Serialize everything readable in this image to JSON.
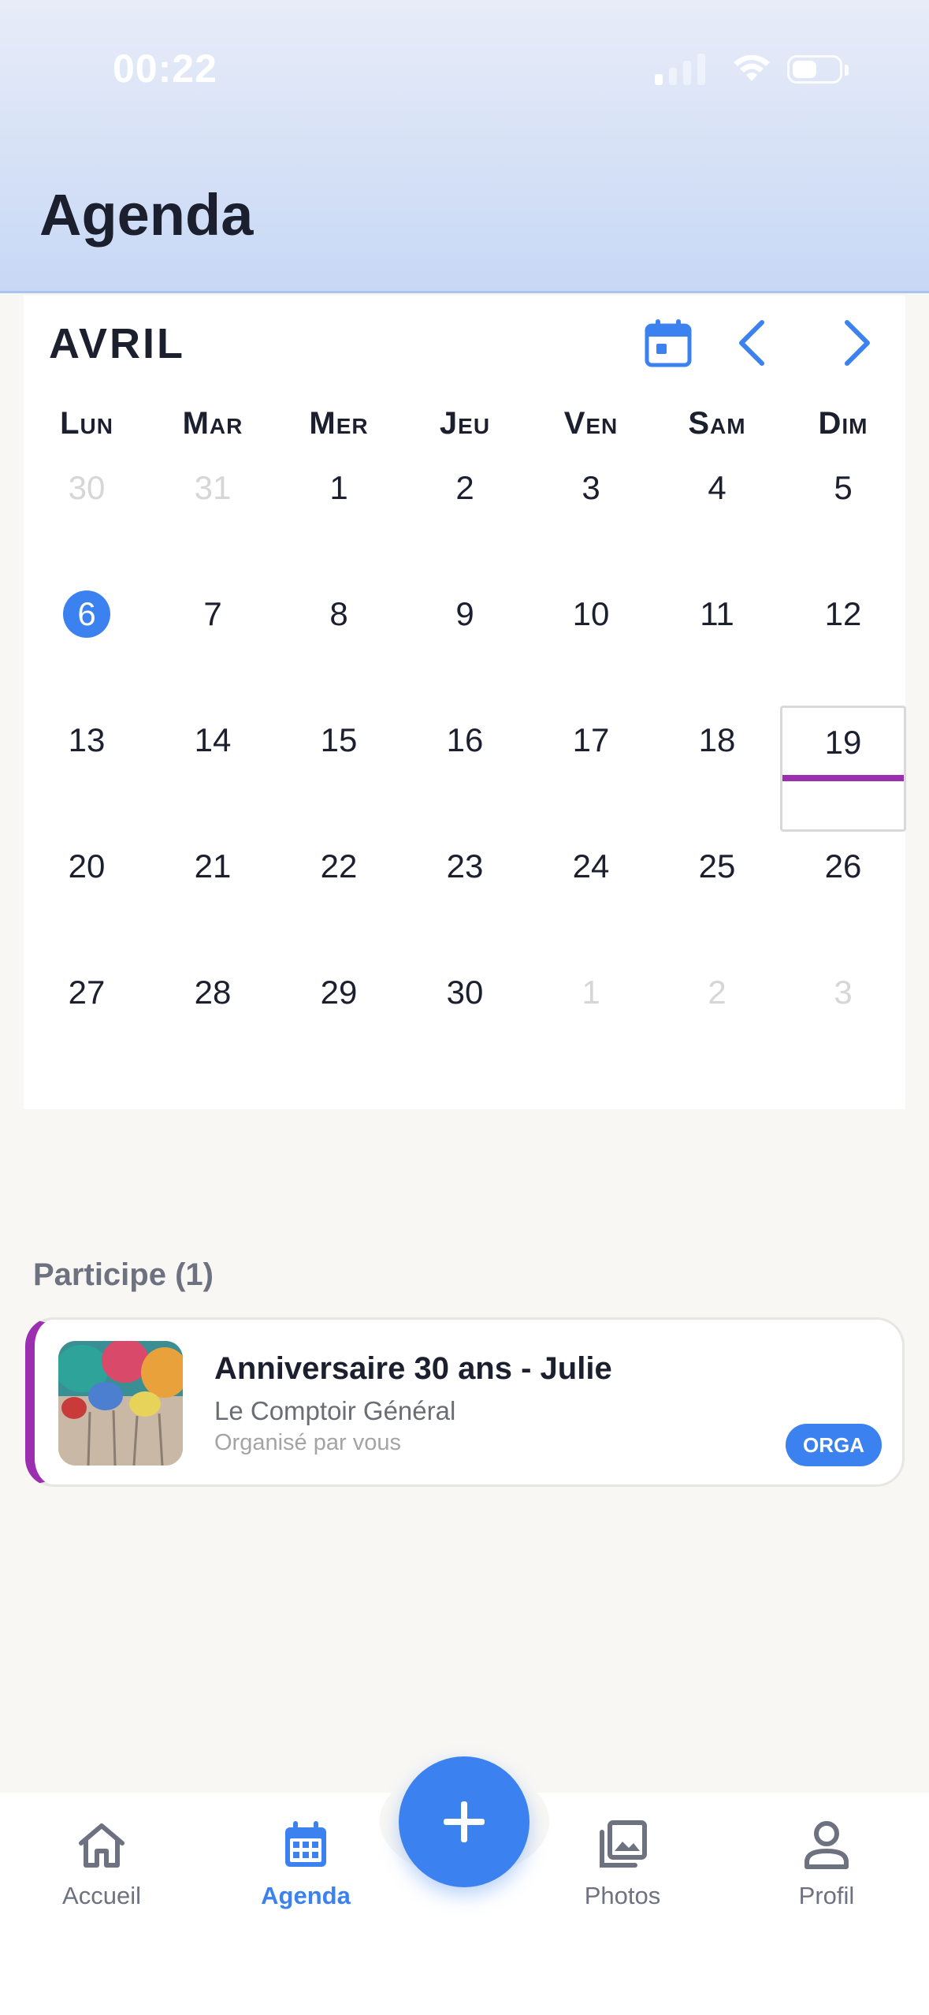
{
  "status_bar": {
    "time": "00:22"
  },
  "header": {
    "title": "Agenda"
  },
  "calendar": {
    "month": "AVRIL",
    "weekdays": [
      "Lun",
      "Mar",
      "Mer",
      "Jeu",
      "Ven",
      "Sam",
      "Dim"
    ],
    "days": [
      {
        "label": "30",
        "muted": true
      },
      {
        "label": "31",
        "muted": true
      },
      {
        "label": "1"
      },
      {
        "label": "2"
      },
      {
        "label": "3"
      },
      {
        "label": "4"
      },
      {
        "label": "5"
      },
      {
        "label": "6",
        "today": true
      },
      {
        "label": "7"
      },
      {
        "label": "8"
      },
      {
        "label": "9"
      },
      {
        "label": "10"
      },
      {
        "label": "11"
      },
      {
        "label": "12"
      },
      {
        "label": "13"
      },
      {
        "label": "14"
      },
      {
        "label": "15"
      },
      {
        "label": "16"
      },
      {
        "label": "17"
      },
      {
        "label": "18"
      },
      {
        "label": "19",
        "event": true
      },
      {
        "label": "20"
      },
      {
        "label": "21"
      },
      {
        "label": "22"
      },
      {
        "label": "23"
      },
      {
        "label": "24"
      },
      {
        "label": "25"
      },
      {
        "label": "26"
      },
      {
        "label": "27"
      },
      {
        "label": "28"
      },
      {
        "label": "29"
      },
      {
        "label": "30"
      },
      {
        "label": "1",
        "muted": true
      },
      {
        "label": "2",
        "muted": true
      },
      {
        "label": "3",
        "muted": true
      }
    ]
  },
  "section": {
    "label": "Participe (1)"
  },
  "event": {
    "title": "Anniversaire 30 ans - Julie",
    "venue": "Le Comptoir Général",
    "organizer": "Organisé par vous",
    "badge": "ORGA"
  },
  "bottom_nav": {
    "items": [
      {
        "label": "Accueil",
        "icon": "home-icon"
      },
      {
        "label": "Agenda",
        "icon": "calendar-icon",
        "active": true
      },
      {
        "label": "Photos",
        "icon": "photos-icon"
      },
      {
        "label": "Profil",
        "icon": "profile-icon"
      }
    ],
    "fab_icon": "plus-icon"
  },
  "colors": {
    "accent": "#3b82f0",
    "event": "#9b2fb0",
    "background": "#f8f7f4"
  }
}
